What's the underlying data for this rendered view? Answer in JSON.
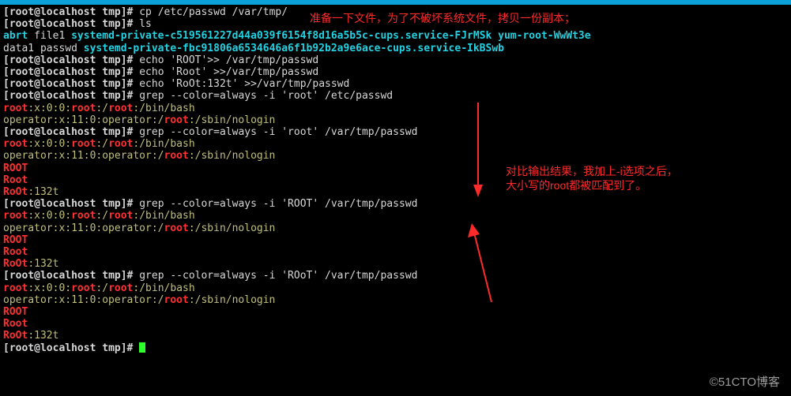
{
  "titlebar": {
    "connected": true
  },
  "annotations": {
    "note_top": "准备一下文件，为了不破坏系统文件，拷贝一份副本；",
    "note_right_1": "对比输出结果，我加上-i选项之后，",
    "note_right_2": "大小写的root都被匹配到了。"
  },
  "prompt": {
    "user": "root",
    "at": "@",
    "host": "localhost",
    "dir": "tmp",
    "sep_l": "[",
    "sep_r": "]#"
  },
  "cmd": {
    "cp": "cp /etc/passwd /var/tmp/",
    "ls": "ls",
    "echo1_a": "echo 'ROOT'>> /var/tmp/passwd",
    "echo2_a": "echo 'Root' >>/var/tmp/passwd",
    "echo3_a": "echo 'RoOt:132t' >>/var/tmp/passwd",
    "grep1": "grep --color=always  -i 'root' /etc/passwd",
    "grep2": "grep --color=always  -i 'root' /var/tmp/passwd",
    "grep3": "grep --color=always  -i 'ROOT' /var/tmp/passwd",
    "grep4": "grep --color=always   -i 'ROoT' /var/tmp/passwd"
  },
  "ls_out": {
    "abrt": "abrt",
    "file1": "file1",
    "svc1": "systemd-private-c519561227d44a039f6154f8d16a5b5c-cups.service-FJrMSk",
    "yum": "yum-root-WwWt3e",
    "data1": "data1",
    "passwd": "passwd",
    "svc2": "systemd-private-fbc91806a6534646a6f1b92b2a9e6ace-cups.service-IkBSwb"
  },
  "grep_out": {
    "line1_a": "root",
    "line1_b": ":x:0:0:",
    "line1_c": "root",
    "line1_d": ":/",
    "line1_e": "root",
    "line1_f": ":/bin/bash",
    "line2_a": "operator:x:11:0:operator:/",
    "line2_b": "root",
    "line2_c": ":/sbin/nologin",
    "extra1": "ROOT",
    "extra2": "Root",
    "extra3_a": "RoOt",
    "extra3_b": ":132t"
  },
  "watermark": "©51CTO博客"
}
